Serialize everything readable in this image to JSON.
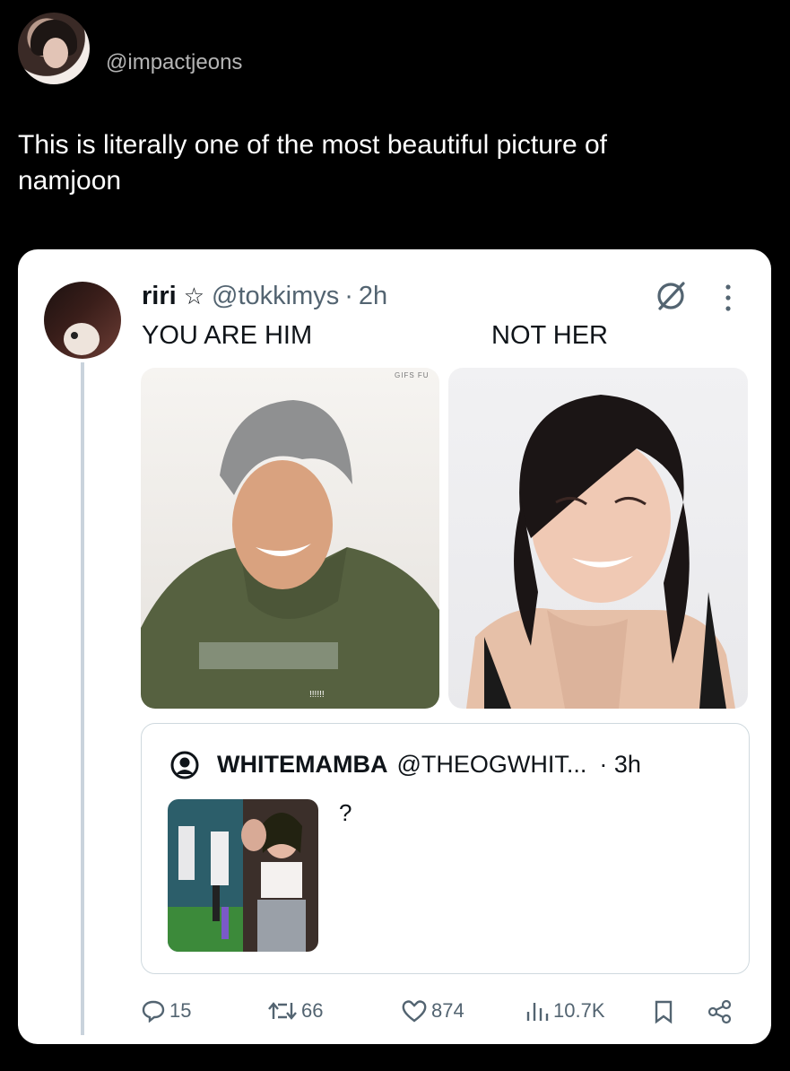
{
  "outer_post": {
    "handle": "@impactjeons",
    "text": "This is literally one of the most beautiful picture of namjoon"
  },
  "tweet": {
    "name": "riri",
    "star": "☆",
    "handle": "@tokkimys",
    "separator": "·",
    "time": "2h",
    "caption_left": "YOU ARE HIM",
    "caption_right": "NOT HER",
    "image_watermark": "GIFS FU"
  },
  "quoted": {
    "name": "WHITEMAMBA",
    "handle": "@THEOGWHIT...",
    "time": "· 3h",
    "text": "?"
  },
  "actions": {
    "replies": "15",
    "reposts": "66",
    "likes": "874",
    "views": "10.7K"
  },
  "colors": {
    "accent_text": "#0f1419",
    "muted_text": "#536471",
    "thread_line": "#c9d3dc",
    "border": "#cfd9de"
  },
  "icons": [
    "reply-icon",
    "repost-icon",
    "like-icon",
    "views-icon",
    "bookmark-icon",
    "share-icon",
    "grok-icon",
    "more-icon",
    "default-avatar-icon"
  ]
}
